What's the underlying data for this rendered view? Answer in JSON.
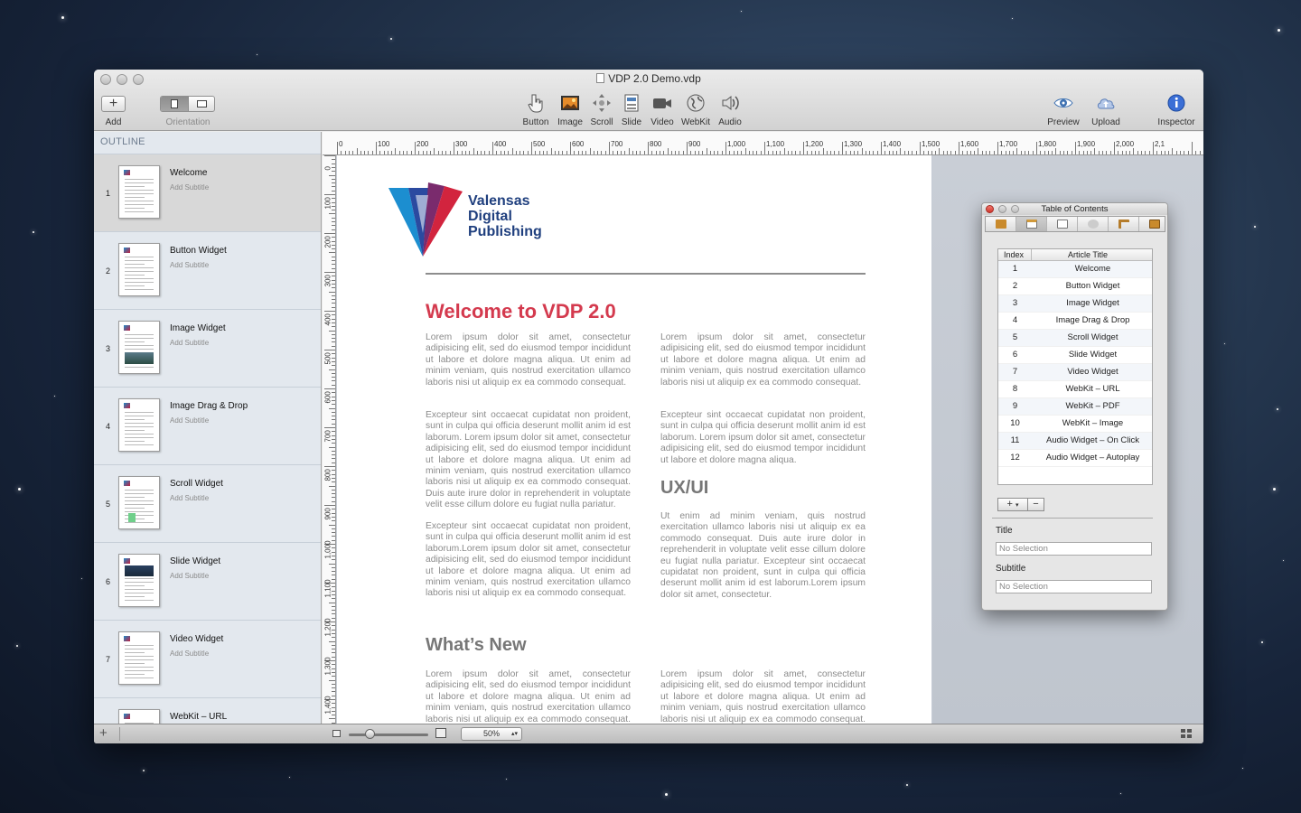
{
  "window": {
    "title": "VDP 2.0 Demo.vdp"
  },
  "toolbar": {
    "add_label": "Add",
    "orientation_label": "Orientation",
    "widgets": [
      {
        "label": "Button",
        "icon": "hand-pointer-icon"
      },
      {
        "label": "Image",
        "icon": "image-icon"
      },
      {
        "label": "Scroll",
        "icon": "scroll-arrows-icon"
      },
      {
        "label": "Slide",
        "icon": "slide-icon"
      },
      {
        "label": "Video",
        "icon": "video-camera-icon"
      },
      {
        "label": "WebKit",
        "icon": "globe-icon"
      },
      {
        "label": "Audio",
        "icon": "speaker-icon"
      }
    ],
    "right": [
      {
        "label": "Preview",
        "icon": "eye-icon"
      },
      {
        "label": "Upload",
        "icon": "cloud-upload-icon"
      },
      {
        "label": "Inspector",
        "icon": "info-icon"
      }
    ]
  },
  "sidebar": {
    "header": "OUTLINE",
    "items": [
      {
        "num": "1",
        "title": "Welcome",
        "subtitle": "Add Subtitle",
        "selected": true
      },
      {
        "num": "2",
        "title": "Button Widget",
        "subtitle": "Add Subtitle"
      },
      {
        "num": "3",
        "title": "Image Widget",
        "subtitle": "Add Subtitle"
      },
      {
        "num": "4",
        "title": "Image Drag & Drop",
        "subtitle": "Add Subtitle"
      },
      {
        "num": "5",
        "title": "Scroll Widget",
        "subtitle": "Add Subtitle"
      },
      {
        "num": "6",
        "title": "Slide Widget",
        "subtitle": "Add Subtitle"
      },
      {
        "num": "7",
        "title": "Video Widget",
        "subtitle": "Add Subtitle"
      },
      {
        "num": "8",
        "title": "WebKit – URL",
        "subtitle": ""
      }
    ]
  },
  "rulers": {
    "top": [
      "0",
      "100",
      "200",
      "300",
      "400",
      "500",
      "600",
      "700",
      "800",
      "900",
      "1,000",
      "1,100",
      "1,200",
      "1,300",
      "1,400",
      "1,500",
      "1,600",
      "1,700",
      "1,800",
      "1,900",
      "2,000",
      "2,1"
    ],
    "left": [
      "0",
      "100",
      "200",
      "300",
      "400",
      "500",
      "600",
      "700",
      "800",
      "900",
      "1,000",
      "1,100",
      "1,200",
      "1,300",
      "1,400"
    ]
  },
  "page": {
    "logo_lines": [
      "Valensas",
      "Digital",
      "Publishing"
    ],
    "heading1": "Welcome to VDP 2.0",
    "heading2": "UX/UI",
    "heading3": "What’s New",
    "col1_p1": "Lorem ipsum dolor sit amet, consectetur adipisicing elit, sed do eiusmod tempor incididunt ut labore et dolore magna aliqua. Ut enim ad minim veniam, quis nostrud exercitation ullamco laboris nisi ut aliquip ex ea commodo consequat.",
    "col1_p2": "Excepteur sint occaecat cupidatat non proident, sunt in culpa qui officia deserunt mollit anim id est laborum. Lorem ipsum dolor sit amet, consectetur adipisicing elit, sed do eiusmod tempor incididunt ut labore et dolore magna aliqua. Ut enim ad minim veniam, quis nostrud exercitation ullamco laboris nisi ut aliquip ex ea commodo consequat. Duis aute irure dolor in reprehenderit in voluptate velit esse cillum dolore eu fugiat nulla pariatur.",
    "col1_p3": "Excepteur sint occaecat cupidatat non proident, sunt in culpa qui officia deserunt mollit anim id est laborum.Lorem ipsum dolor sit amet, consectetur adipisicing elit, sed do eiusmod tempor incididunt ut labore et dolore magna aliqua. Ut enim ad minim veniam, quis nostrud exercitation ullamco laboris nisi ut aliquip ex ea commodo consequat.",
    "col1_p4": "Lorem ipsum dolor sit amet, consectetur adipisicing elit, sed do eiusmod tempor incididunt ut labore et dolore magna aliqua. Ut enim ad minim veniam, quis nostrud exercitation ullamco laboris nisi ut aliquip ex ea commodo consequat. Duis",
    "col2_p1": "Lorem ipsum dolor sit amet, consectetur adipisicing elit, sed do eiusmod tempor incididunt ut labore et dolore magna aliqua. Ut enim ad minim veniam, quis nostrud exercitation ullamco laboris nisi ut aliquip ex ea commodo consequat.",
    "col2_p2": "Excepteur sint occaecat cupidatat non proident, sunt in culpa qui officia deserunt mollit anim id est laborum. Lorem ipsum dolor sit amet, consectetur adipisicing elit, sed do eiusmod tempor incididunt ut labore et dolore magna aliqua.",
    "col2_p3": "Ut enim ad minim veniam, quis nostrud exercitation ullamco laboris nisi ut aliquip ex ea commodo consequat. Duis aute irure dolor in reprehenderit in voluptate velit esse cillum dolore eu fugiat nulla pariatur. Excepteur sint occaecat cupidatat non proident, sunt in culpa qui officia deserunt mollit anim id est laborum.Lorem ipsum dolor sit amet, consectetur.",
    "col2_p4": "Lorem ipsum dolor sit amet, consectetur adipisicing elit, sed do eiusmod tempor incididunt ut labore et dolore magna aliqua. Ut enim ad minim veniam, quis nostrud exercitation ullamco laboris nisi ut aliquip ex ea commodo consequat. Duis"
  },
  "bottombar": {
    "zoom": "50%"
  },
  "toc": {
    "title": "Table of Contents",
    "col_index": "Index",
    "col_title": "Article Title",
    "rows": [
      {
        "index": "1",
        "title": "Welcome"
      },
      {
        "index": "2",
        "title": "Button Widget"
      },
      {
        "index": "3",
        "title": "Image Widget"
      },
      {
        "index": "4",
        "title": "Image Drag & Drop"
      },
      {
        "index": "5",
        "title": "Scroll Widget"
      },
      {
        "index": "6",
        "title": "Slide Widget"
      },
      {
        "index": "7",
        "title": "Video Widget"
      },
      {
        "index": "8",
        "title": "WebKit – URL"
      },
      {
        "index": "9",
        "title": "WebKit – PDF"
      },
      {
        "index": "10",
        "title": "WebKit – Image"
      },
      {
        "index": "11",
        "title": "Audio Widget –  On Click"
      },
      {
        "index": "12",
        "title": "Audio Widget – Autoplay"
      }
    ],
    "add_symbol": "+",
    "remove_symbol": "−",
    "title_label": "Title",
    "title_value": "No Selection",
    "subtitle_label": "Subtitle",
    "subtitle_value": "No Selection"
  },
  "colors": {
    "accent_red": "#d43a4e",
    "logo_blue": "#1f3f7e",
    "close_button": "#e0473e"
  }
}
